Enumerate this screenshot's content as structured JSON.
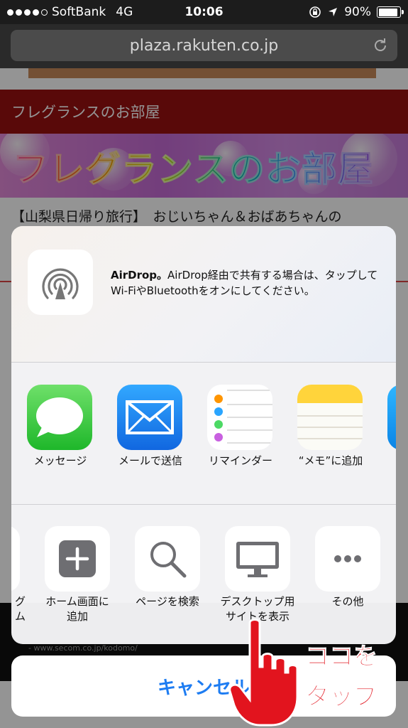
{
  "status_bar": {
    "carrier": "SoftBank",
    "network": "4G",
    "time": "10:06",
    "battery": "90%",
    "battery_level": 0.9
  },
  "browser": {
    "url": "plaza.rakuten.co.jp"
  },
  "page": {
    "blog_header": "フレグランスのお部屋",
    "banner_title": "フレグランスのお部屋",
    "article_title": "【山梨県日帰り旅行】　おじいちゃん＆おばあちゃんの"
  },
  "share_sheet": {
    "airdrop": {
      "title": "AirDrop。",
      "description": "AirDrop経由で共有する場合は、タップしてWi-FiやBluetoothをオンにしてください。"
    },
    "apps": [
      {
        "label": "メッセージ",
        "icon": "messages-icon"
      },
      {
        "label": "メールで送信",
        "icon": "mail-icon"
      },
      {
        "label": "リマインダー",
        "icon": "reminders-icon"
      },
      {
        "label": "“メモ”に追加",
        "icon": "notes-icon"
      }
    ],
    "actions": [
      {
        "label": "グ\nム",
        "icon": "partial-icon"
      },
      {
        "label": "ホーム画面に\n追加",
        "icon": "add-to-home-icon"
      },
      {
        "label": "ページを検索",
        "icon": "search-icon"
      },
      {
        "label": "デスクトップ用\nサイトを表示",
        "icon": "desktop-icon"
      },
      {
        "label": "その他",
        "icon": "more-icon"
      }
    ],
    "cancel_label": "キャンセル"
  },
  "annotation": {
    "line1": "ココを",
    "line2": "タップ"
  },
  "colors": {
    "accent": "#1d7cf2",
    "header_red": "#9a1010",
    "annotation_red": "#e2141e"
  }
}
